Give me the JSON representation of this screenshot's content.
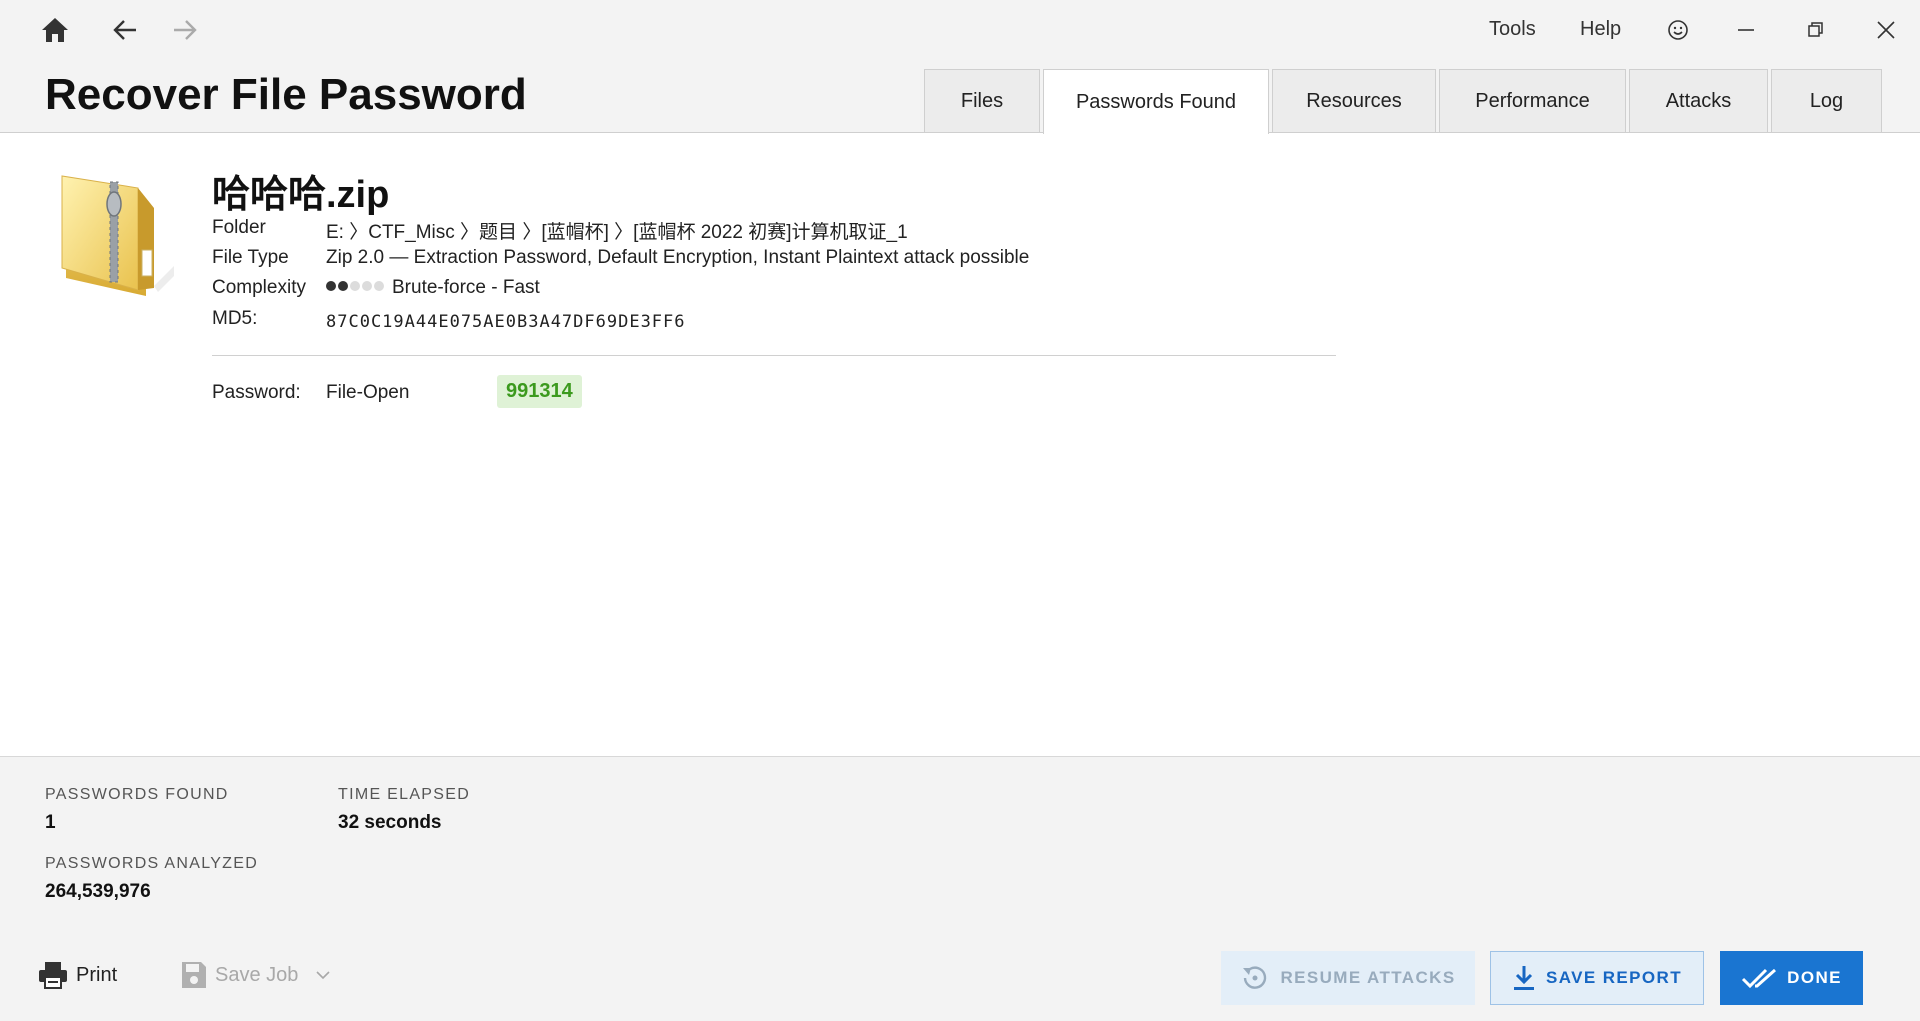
{
  "nav": {
    "home_icon": "home-icon",
    "back_icon": "arrow-left-icon",
    "forward_icon": "arrow-right-icon"
  },
  "menu": {
    "tools": "Tools",
    "help": "Help",
    "feedback_icon": "smiley-icon"
  },
  "window_controls": [
    "minimize-icon",
    "restore-icon",
    "close-icon"
  ],
  "header": {
    "title": "Recover File Password"
  },
  "tabs": [
    {
      "label": "Files",
      "active": false
    },
    {
      "label": "Passwords Found",
      "active": true
    },
    {
      "label": "Resources",
      "active": false
    },
    {
      "label": "Performance",
      "active": false
    },
    {
      "label": "Attacks",
      "active": false
    },
    {
      "label": "Log",
      "active": false
    }
  ],
  "file": {
    "icon": "zip-folder-icon",
    "name": "哈哈哈.zip",
    "folder_label": "Folder",
    "folder_value": "E: 〉CTF_Misc 〉题目 〉[蓝帽杯] 〉[蓝帽杯 2022 初赛]计算机取证_1",
    "type_label": "File Type",
    "type_value": "Zip 2.0 — Extraction Password, Default Encryption, Instant Plaintext attack possible",
    "complexity_label": "Complexity",
    "complexity_level": 2,
    "complexity_max": 5,
    "complexity_value": "Brute-force - Fast",
    "md5_label": "MD5:",
    "md5_value": "87C0C19A44E075AE0B3A47DF69DE3FF6"
  },
  "password": {
    "label": "Password:",
    "type": "File-Open",
    "value": "991314",
    "highlight_color": "#dff2d6",
    "text_color": "#3c9a1e"
  },
  "stats": {
    "found_label": "PASSWORDS FOUND",
    "found_value": "1",
    "elapsed_label": "TIME ELAPSED",
    "elapsed_value": "32 seconds",
    "analyzed_label": "PASSWORDS ANALYZED",
    "analyzed_value": "264,539,976"
  },
  "footer": {
    "print_label": "Print",
    "print_icon": "printer-icon",
    "save_job_label": "Save Job",
    "save_job_icon": "floppy-disk-icon",
    "save_job_disabled": true,
    "resume_label": "RESUME ATTACKS",
    "resume_icon": "resume-icon",
    "resume_disabled": true,
    "save_report_label": "SAVE REPORT",
    "save_report_icon": "download-icon",
    "done_label": "DONE",
    "done_icon": "double-check-icon",
    "accent_color": "#1a75d1"
  }
}
